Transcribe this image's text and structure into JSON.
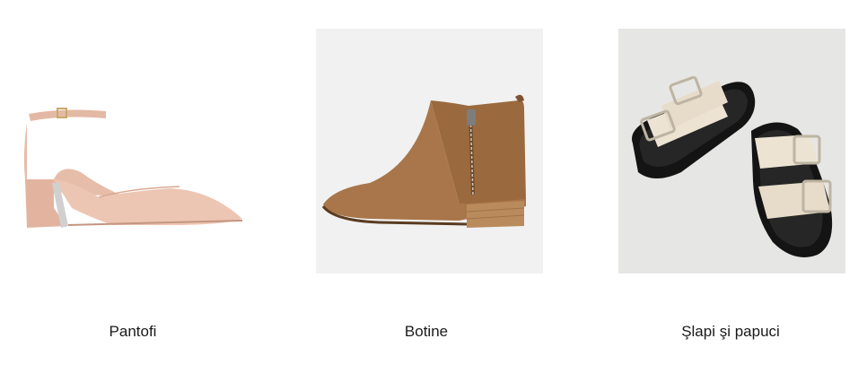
{
  "categories": [
    {
      "label": "Pantofi",
      "icon": "pump-shoe-icon"
    },
    {
      "label": "Botine",
      "icon": "ankle-boot-icon"
    },
    {
      "label": "Şlapi şi papuci",
      "icon": "slide-sandals-icon"
    }
  ],
  "colors": {
    "pump": "#e8c3b0",
    "boot": "#9b6a3e",
    "sandal_strap": "#ece3d3",
    "sandal_sole": "#141414"
  }
}
